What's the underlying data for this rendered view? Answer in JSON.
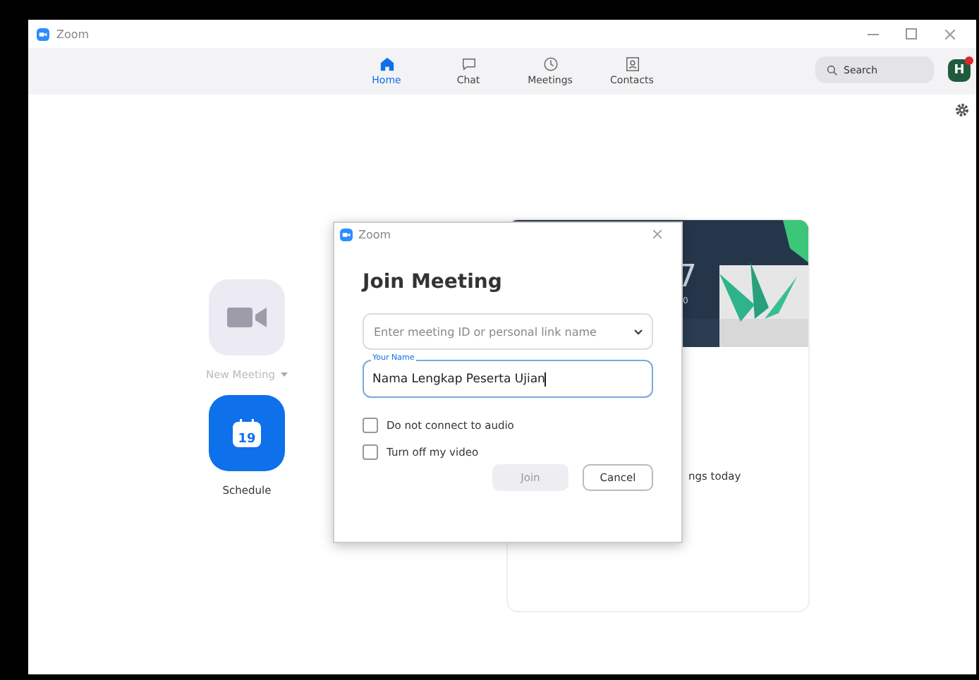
{
  "window": {
    "title": "Zoom"
  },
  "tabs": [
    {
      "label": "Home",
      "selected": true
    },
    {
      "label": "Chat",
      "selected": false
    },
    {
      "label": "Meetings",
      "selected": false
    },
    {
      "label": "Contacts",
      "selected": false
    }
  ],
  "search": {
    "placeholder": "Search"
  },
  "avatar": {
    "initial": "H",
    "notification": true
  },
  "actions": [
    {
      "label": "New Meeting",
      "disabled": true,
      "has_menu": true
    },
    {
      "label": "Schedule",
      "day": "19",
      "disabled": false,
      "has_menu": false
    }
  ],
  "card": {
    "time_fragment": "7",
    "date_fragment": "0",
    "meetings_fragment": "ngs today"
  },
  "dialog": {
    "title": "Zoom",
    "heading": "Join Meeting",
    "meeting_id": {
      "placeholder": "Enter meeting ID or personal link name"
    },
    "name": {
      "label": "Your Name",
      "value": "Nama Lengkap Peserta Ujian"
    },
    "options": [
      {
        "label": "Do not connect to audio",
        "checked": false
      },
      {
        "label": "Turn off my video",
        "checked": false
      }
    ],
    "buttons": [
      {
        "label": "Join",
        "kind": "primary",
        "disabled": true
      },
      {
        "label": "Cancel",
        "kind": "secondary",
        "disabled": false
      }
    ]
  }
}
